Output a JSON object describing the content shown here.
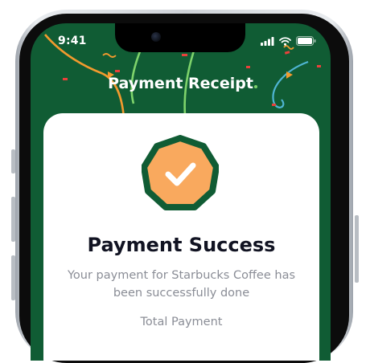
{
  "status_bar": {
    "time": "9:41",
    "icons": [
      "signal-icon",
      "wifi-icon",
      "battery-icon"
    ]
  },
  "header": {
    "title": "Payment Receipt"
  },
  "receipt": {
    "status_title": "Payment Success",
    "description": "Your payment for Starbucks Coffee has been successfully done",
    "total_label": "Total Payment",
    "badge_icon": "check-icon"
  },
  "colors": {
    "screen_background": "#105c34",
    "badge_fill": "#f9a95e",
    "badge_border": "#105c34",
    "confetti_orange": "#f29a2e",
    "confetti_green": "#7ed36b",
    "confetti_blue": "#4fb5d3",
    "confetti_red": "#e8413b"
  }
}
